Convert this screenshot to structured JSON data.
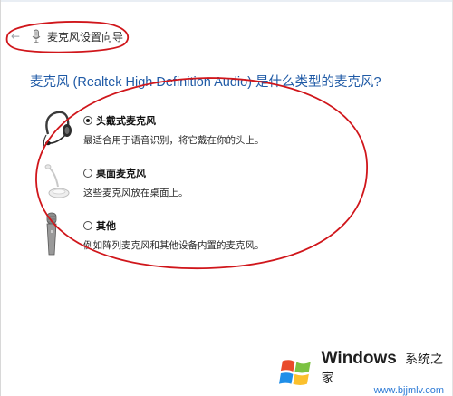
{
  "header": {
    "back_glyph": "←",
    "title": "麦克风设置向导"
  },
  "question": "麦克风 (Realtek High Definition Audio) 是什么类型的麦克风?",
  "options": [
    {
      "label": "头戴式麦克风",
      "description": "最适合用于语音识别，将它戴在你的头上。",
      "checked": true,
      "icon": "headset-icon"
    },
    {
      "label": "桌面麦克风",
      "description": "这些麦克风放在桌面上。",
      "checked": false,
      "icon": "desktop-mic-icon"
    },
    {
      "label": "其他",
      "description": "例如阵列麦克风和其他设备内置的麦克风。",
      "checked": false,
      "icon": "handheld-mic-icon"
    }
  ],
  "watermark": {
    "brand": "Windows",
    "brand_cn": "系统之家",
    "url": "www.bjjmlv.com"
  },
  "colors": {
    "question_text": "#1f5aa6",
    "annotation": "#d0161b",
    "watermark_url": "#2e7bd6"
  }
}
